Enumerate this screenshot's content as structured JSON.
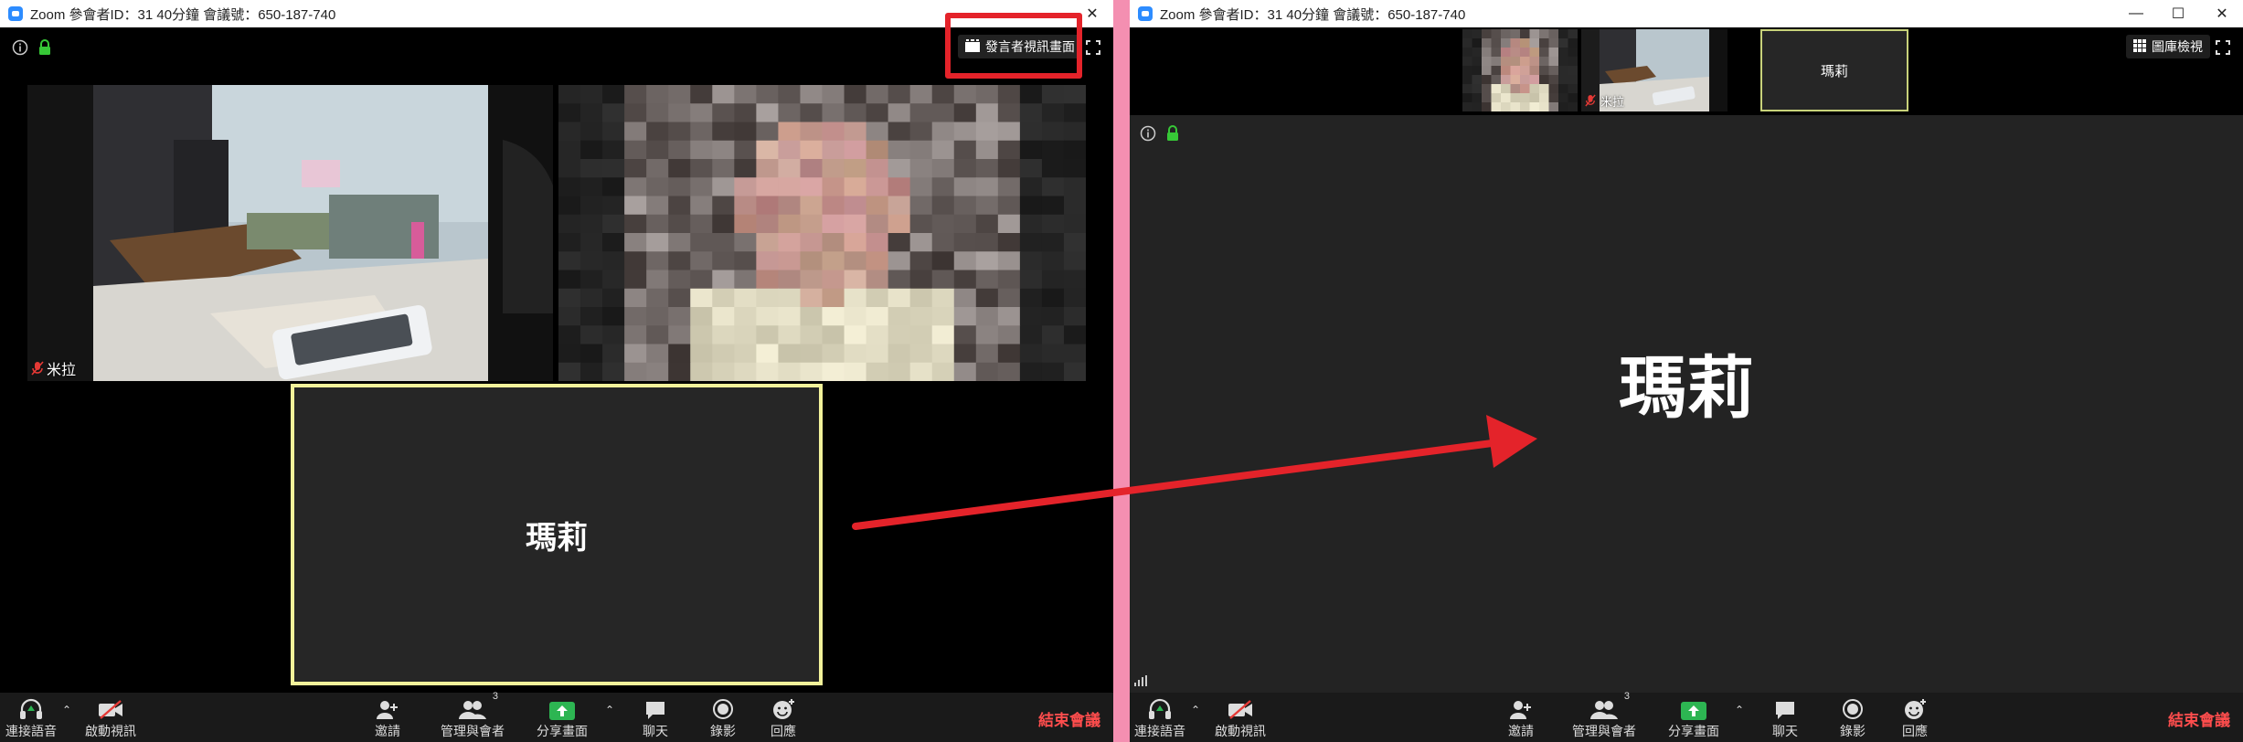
{
  "left_window": {
    "title": "Zoom 參會者ID：31  40分鐘 會議號：650-187-740",
    "fullscreen_button_label": "發言者視訊畫面",
    "tiles": [
      {
        "name": "米拉",
        "muted": true
      },
      {
        "name": ""
      },
      {
        "name": "瑪莉",
        "active_speaker": true
      }
    ],
    "toolbar": {
      "audio": "連接語音",
      "video": "啟動視訊",
      "invite": "邀請",
      "participants": "管理與會者",
      "participants_count": "3",
      "share": "分享畫面",
      "chat": "聊天",
      "record": "錄影",
      "reactions": "回應",
      "end": "結束會議"
    }
  },
  "right_window": {
    "title": "Zoom 參會者ID：31  40分鐘 會議號：650-187-740",
    "gallery_button_label": "圖庫檢視",
    "thumbnails": [
      {
        "name": ""
      },
      {
        "name": "米拉",
        "muted": true
      },
      {
        "name": "瑪莉"
      }
    ],
    "speaker_name": "瑪莉",
    "toolbar": {
      "audio": "連接語音",
      "video": "啟動視訊",
      "invite": "邀請",
      "participants": "管理與會者",
      "participants_count": "3",
      "share": "分享畫面",
      "chat": "聊天",
      "record": "錄影",
      "reactions": "回應",
      "end": "結束會議"
    }
  },
  "colors": {
    "highlight_red": "#e4232a",
    "arrow_red": "#e4232a",
    "active_speaker_border": "#f2f29a",
    "share_green": "#2db552",
    "end_red": "#ff4d4d",
    "divider_pink": "#f48fb1",
    "lock_green": "#37c837"
  },
  "icons": {
    "info": "info-icon",
    "lock": "lock-icon",
    "fullscreen": "fullscreen-icon",
    "speaker_view": "speaker-view-icon",
    "gallery": "gallery-grid-icon",
    "signal": "signal-bars-icon"
  }
}
